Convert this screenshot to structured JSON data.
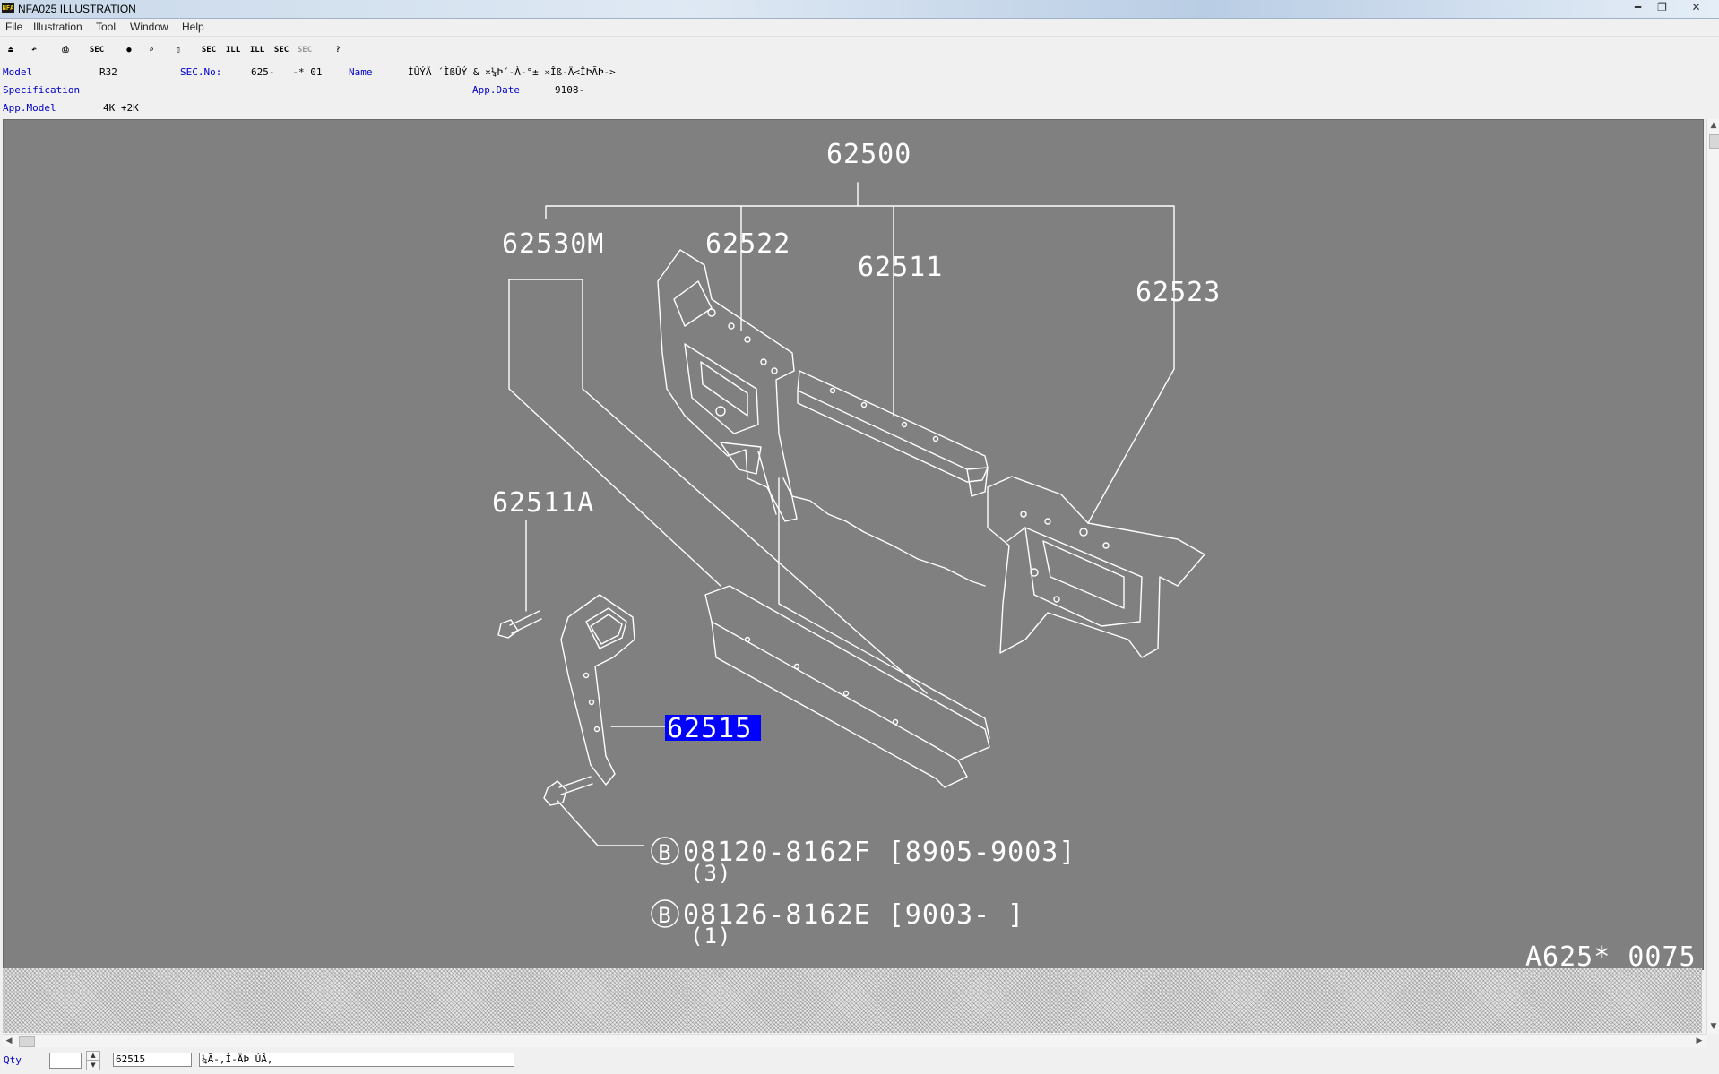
{
  "window": {
    "title": "NFA025  ILLUSTRATION",
    "app_icon_text": "NFA",
    "controls": [
      "minimize-icon",
      "restore-icon",
      "close-icon"
    ]
  },
  "menu": [
    "File",
    "Illustration",
    "Tool",
    "Window",
    "Help"
  ],
  "toolbar": {
    "buttons": [
      {
        "name": "exit-icon",
        "glyph": "⏏"
      },
      {
        "name": "undo-icon",
        "glyph": "↶"
      },
      {
        "name": "print-icon",
        "glyph": "⎙"
      },
      {
        "name": "sec-list-icon",
        "glyph": "SEC"
      },
      {
        "name": "circle-icon",
        "glyph": "●"
      },
      {
        "name": "zoom-icon",
        "glyph": "⌕"
      },
      {
        "name": "book-icon",
        "glyph": "▯"
      },
      {
        "name": "prev-sec-icon",
        "glyph": "SEC"
      },
      {
        "name": "prev-ill-icon",
        "glyph": "ILL"
      },
      {
        "name": "next-ill-icon",
        "glyph": "ILL"
      },
      {
        "name": "next-sec-icon",
        "glyph": "SEC"
      },
      {
        "name": "sec-disabled-icon",
        "glyph": "SEC"
      },
      {
        "name": "help-icon",
        "glyph": "?"
      }
    ]
  },
  "info": {
    "model_label": "Model",
    "model_value": "R32",
    "secno_label": "SEC.No:",
    "secno_value": "625-   -* 01",
    "name_label": "Name",
    "name_value": "ÌÛÝÄ ´ÌßÛÝ & ×¼Þ´-À-°± »Îß-Ä<ÎÞÃÞ->",
    "spec_label": "Specification",
    "spec_value": "",
    "appdate_label": "App.Date",
    "appdate_value": "9108-",
    "appmodel_label": "App.Model",
    "appmodel_value": "4K +2K"
  },
  "diagram": {
    "callouts": {
      "assembly": "62500",
      "p62530m": "62530M",
      "p62522": "62522",
      "p62511": "62511",
      "p62523": "62523",
      "p62511a": "62511A",
      "p62515": "62515"
    },
    "bolt1_symbol": "B",
    "bolt1_part": "08120-8162F [8905-9003]",
    "bolt1_qty": "(3)",
    "bolt2_symbol": "B",
    "bolt2_part": "08126-8162E [9003-   ]",
    "bolt2_qty": "(1)",
    "ref_code": "A625* 0075",
    "colors": {
      "background": "#808080",
      "lines": "#ffffff",
      "highlight": "#0000ff"
    }
  },
  "status": {
    "qty_label": "Qty",
    "qty_value": "",
    "part_number": "62515",
    "part_name": "¼Ã-,Ì-ÄÞ ÚÂ,"
  }
}
